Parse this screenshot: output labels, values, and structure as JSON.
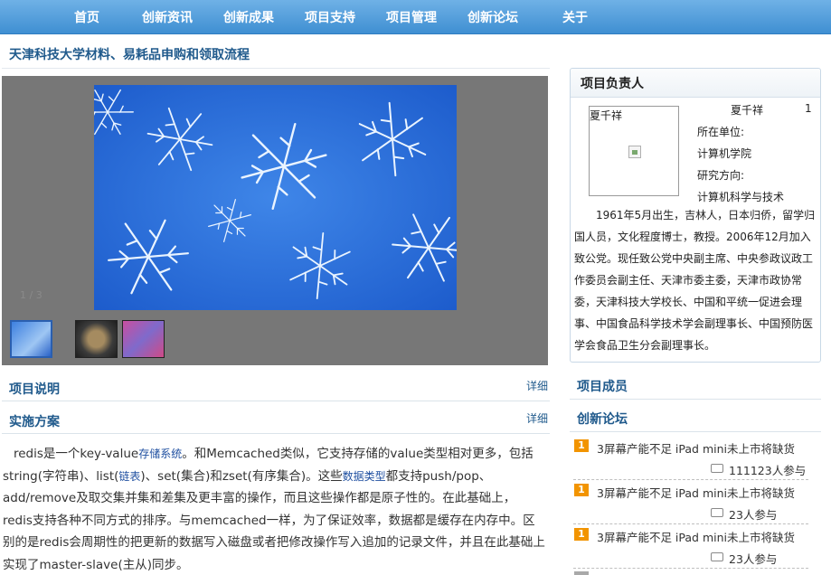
{
  "nav": {
    "items": [
      "首页",
      "创新资讯",
      "创新成果",
      "项目支持",
      "项目管理",
      "创新论坛",
      "关于"
    ]
  },
  "page": {
    "title": "天津科技大学材料、易耗品申购和领取流程"
  },
  "slider": {
    "counter": "1 / 3"
  },
  "sections": {
    "description": {
      "title": "项目说明",
      "more": "详细"
    },
    "plan": {
      "title": "实施方案",
      "more": "详细"
    }
  },
  "body": {
    "p1": "redis是一个key-value",
    "link1": "存储系统",
    "p2": "。和Memcached类似，它支持存储的value类型相对更多，包括string(字符串)、list(",
    "link2": "链表",
    "p3": ")、set(集合)和zset(有序集合)。这些",
    "link3": "数据类型",
    "p4": "都支持push/pop、add/remove及取交集并集和差集及更丰富的操作，而且这些操作都是原子性的。在此基础上，redis支持各种不同方式的排序。与memcached一样，为了保证效率，数据都是缓存在内存中。区别的是redis会周期性的把更新的数据写入磁盘或者把修改操作写入追加的记录文件，并且在此基础上实现了master-slave(主从)同步。"
  },
  "leader": {
    "title": "项目负责人",
    "photo_name": "夏千祥",
    "name": "夏千祥",
    "index": "1",
    "unit_label": "所在单位:",
    "unit": "计算机学院",
    "field_label": "研究方向:",
    "field": "计算机科学与技术",
    "bio": "1961年5月出生，吉林人，日本归侨，留学归国人员，文化程度博士，教授。2006年12月加入致公党。现任致公党中央副主席、中央参政议政工作委员会副主任、天津市委主委，天津市政协常委，天津科技大学校长、中国和平统一促进会理事、中国食品科学技术学会副理事长、中国预防医学会食品卫生分会副理事长。"
  },
  "sidebar": {
    "members_title": "项目成员",
    "forum_title": "创新论坛",
    "forum": [
      {
        "rank": "1",
        "title": "3屏幕产能不足 iPad mini未上市将缺货",
        "count": "111123人参与"
      },
      {
        "rank": "1",
        "title": "3屏幕产能不足 iPad mini未上市将缺货",
        "count": "23人参与"
      },
      {
        "rank": "1",
        "title": "3屏幕产能不足 iPad mini未上市将缺货",
        "count": "23人参与"
      }
    ]
  },
  "colors": {
    "nav_gradient_top": "#6fb1e6",
    "nav_gradient_bottom": "#3f8fd2",
    "heading_blue": "#205a8c",
    "rank_orange": "#f29400",
    "slider_bg": "#777777"
  }
}
